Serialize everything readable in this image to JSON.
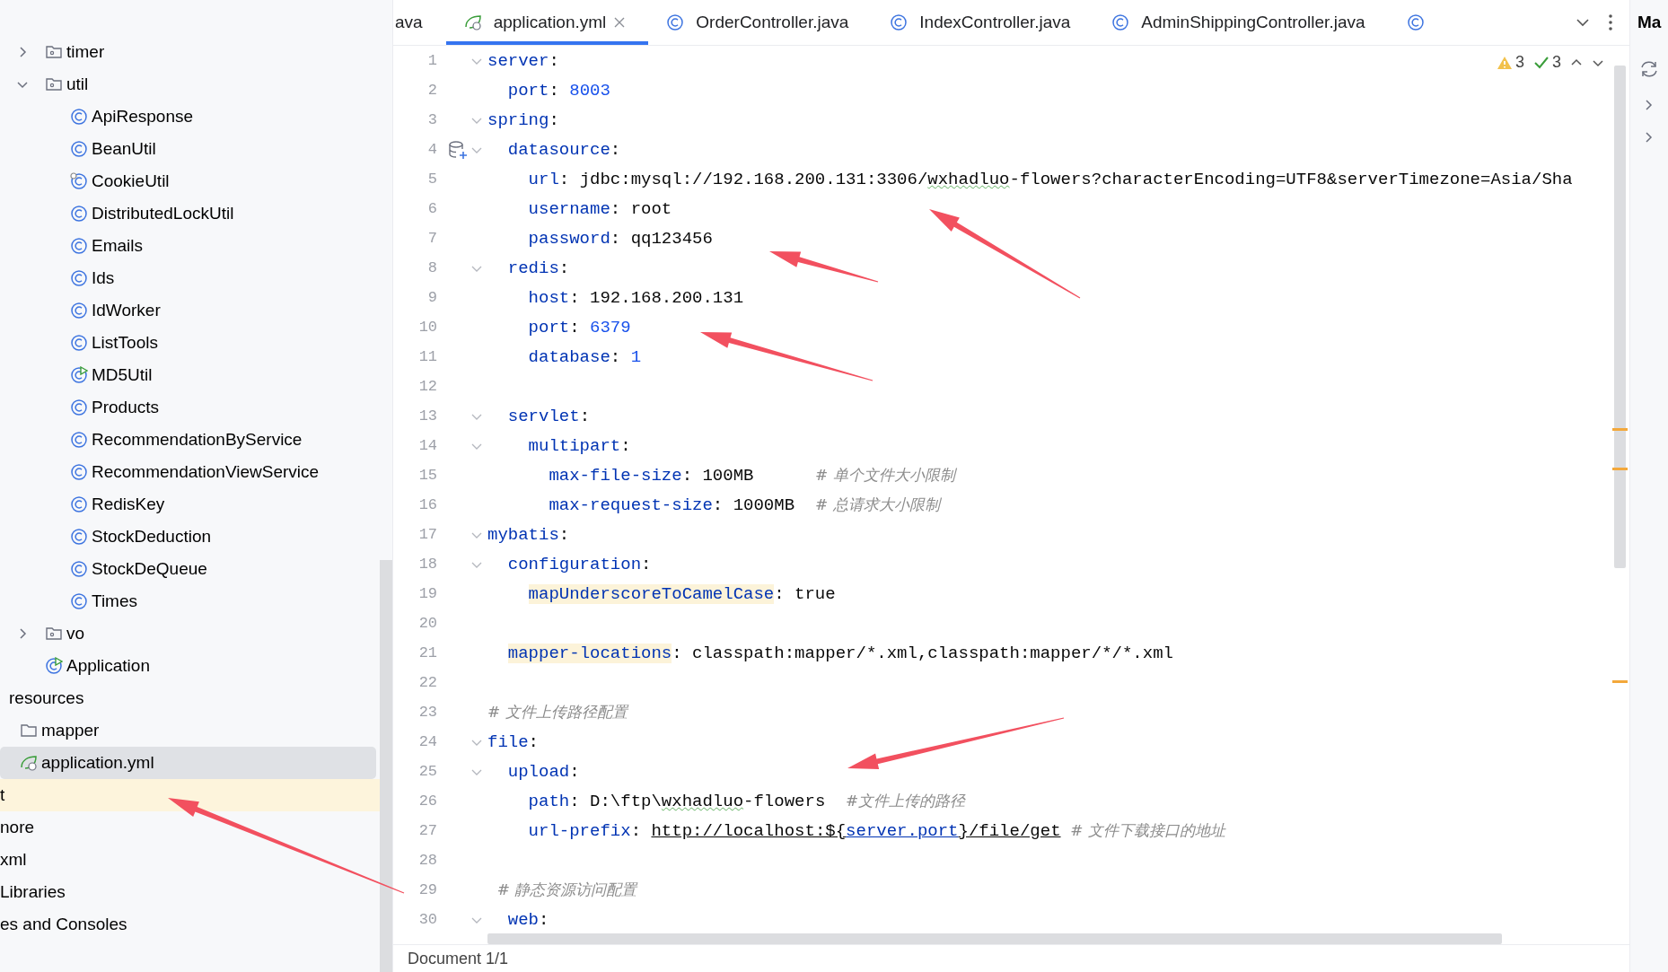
{
  "project_tree": [
    {
      "children": [
        {
          "children": [
            {
              "children": [
                {
                  "label": "timer",
                  "kind": "package",
                  "expanded": false,
                  "selected": false,
                  "excluded": false
                },
                {
                  "label": "util",
                  "kind": "package",
                  "expanded": true,
                  "selected": false,
                  "excluded": false,
                  "children": [
                    {
                      "label": "ApiResponse",
                      "kind": "class",
                      "selected": false,
                      "excluded": false
                    },
                    {
                      "label": "BeanUtil",
                      "kind": "class",
                      "selected": false,
                      "excluded": false
                    },
                    {
                      "label": "CookieUtil",
                      "kind": "class-badge",
                      "selected": false,
                      "excluded": false
                    },
                    {
                      "label": "DistributedLockUtil",
                      "kind": "class",
                      "selected": false,
                      "excluded": false
                    },
                    {
                      "label": "Emails",
                      "kind": "class",
                      "selected": false,
                      "excluded": false
                    },
                    {
                      "label": "Ids",
                      "kind": "class",
                      "selected": false,
                      "excluded": false
                    },
                    {
                      "label": "IdWorker",
                      "kind": "class",
                      "selected": false,
                      "excluded": false
                    },
                    {
                      "label": "ListTools",
                      "kind": "class",
                      "selected": false,
                      "excluded": false
                    },
                    {
                      "label": "MD5Util",
                      "kind": "class-run",
                      "selected": false,
                      "excluded": false
                    },
                    {
                      "label": "Products",
                      "kind": "class",
                      "selected": false,
                      "excluded": false
                    },
                    {
                      "label": "RecommendationByService",
                      "kind": "class",
                      "selected": false,
                      "excluded": false
                    },
                    {
                      "label": "RecommendationViewService",
                      "kind": "class",
                      "selected": false,
                      "excluded": false
                    },
                    {
                      "label": "RedisKey",
                      "kind": "class",
                      "selected": false,
                      "excluded": false
                    },
                    {
                      "label": "StockDeduction",
                      "kind": "class",
                      "selected": false,
                      "excluded": false
                    },
                    {
                      "label": "StockDeQueue",
                      "kind": "class",
                      "selected": false,
                      "excluded": false
                    },
                    {
                      "label": "Times",
                      "kind": "class",
                      "selected": false,
                      "excluded": false
                    }
                  ]
                },
                {
                  "label": "vo",
                  "kind": "package",
                  "expanded": false,
                  "selected": false,
                  "excluded": false
                },
                {
                  "label": "Application",
                  "kind": "class-run",
                  "selected": false,
                  "excluded": false
                }
              ]
            }
          ]
        },
        {
          "label": "resources",
          "selected": false,
          "excluded": false,
          "children": [
            {
              "label": "mapper",
              "kind": "folder",
              "selected": false,
              "excluded": false
            },
            {
              "label": "application.yml",
              "kind": "spring",
              "selected": true,
              "excluded": false
            }
          ]
        }
      ]
    },
    {
      "label": "t",
      "selected": false,
      "excluded": true
    },
    {
      "label": "nore",
      "selected": false,
      "excluded": false
    },
    {
      "label": "xml",
      "selected": false,
      "excluded": false
    },
    {
      "label": "Libraries",
      "selected": false,
      "excluded": false
    },
    {
      "label": "es and Consoles",
      "selected": false,
      "excluded": false
    }
  ],
  "tabs": [
    {
      "label": "ava",
      "selected": false
    },
    {
      "label": "application.yml",
      "kind": "spring",
      "selected": true,
      "closable": true
    },
    {
      "label": "OrderController.java",
      "kind": "class",
      "selected": false
    },
    {
      "label": "IndexController.java",
      "kind": "class",
      "selected": false
    },
    {
      "label": "AdminShippingController.java",
      "kind": "class",
      "selected": false
    },
    {
      "kind": "class",
      "selected": false
    }
  ],
  "right_panel": {
    "title": "Ma"
  },
  "inspections": {
    "warnings": "3",
    "passed": "3"
  },
  "editor_lines": [
    {
      "n": "1",
      "fold": true,
      "tokens": [
        {
          "kind": "key",
          "text": "server"
        },
        {
          "kind": "plain",
          "text": ":"
        }
      ]
    },
    {
      "n": "2",
      "tokens": [
        {
          "kind": "key",
          "text": "  port"
        },
        {
          "kind": "plain",
          "text": ": "
        },
        {
          "kind": "number",
          "text": "8003"
        }
      ]
    },
    {
      "n": "3",
      "fold": true,
      "tokens": [
        {
          "kind": "key",
          "text": "spring"
        },
        {
          "kind": "plain",
          "text": ":"
        }
      ]
    },
    {
      "n": "4",
      "fold": true,
      "tokens": [
        {
          "kind": "key",
          "text": "  datasource"
        },
        {
          "kind": "plain",
          "text": ":"
        }
      ]
    },
    {
      "n": "5",
      "tokens": [
        {
          "kind": "key",
          "text": "    url"
        },
        {
          "kind": "plain",
          "text": ": jdbc:mysql://192.168.200.131:3306/"
        },
        {
          "kind": "typo",
          "text": "wxhadluo"
        },
        {
          "kind": "plain",
          "text": "-flowers?characterEncoding=UTF8&serverTimezone=Asia/Sha"
        }
      ]
    },
    {
      "n": "6",
      "tokens": [
        {
          "kind": "key",
          "text": "    username"
        },
        {
          "kind": "plain",
          "text": ": root"
        }
      ]
    },
    {
      "n": "7",
      "tokens": [
        {
          "kind": "key",
          "text": "    password"
        },
        {
          "kind": "plain",
          "text": ": qq123456"
        }
      ]
    },
    {
      "n": "8",
      "fold": true,
      "tokens": [
        {
          "kind": "key",
          "text": "  redis"
        },
        {
          "kind": "plain",
          "text": ":"
        }
      ]
    },
    {
      "n": "9",
      "tokens": [
        {
          "kind": "key",
          "text": "    host"
        },
        {
          "kind": "plain",
          "text": ": 192.168.200.131"
        }
      ]
    },
    {
      "n": "10",
      "tokens": [
        {
          "kind": "key",
          "text": "    port"
        },
        {
          "kind": "plain",
          "text": ": "
        },
        {
          "kind": "number",
          "text": "6379"
        }
      ]
    },
    {
      "n": "11",
      "tokens": [
        {
          "kind": "key",
          "text": "    database"
        },
        {
          "kind": "plain",
          "text": ": "
        },
        {
          "kind": "number",
          "text": "1"
        }
      ]
    },
    {
      "n": "12"
    },
    {
      "n": "13",
      "fold": true,
      "tokens": [
        {
          "kind": "key",
          "text": "  servlet"
        },
        {
          "kind": "plain",
          "text": ":"
        }
      ]
    },
    {
      "n": "14",
      "fold": true,
      "tokens": [
        {
          "kind": "key",
          "text": "    multipart"
        },
        {
          "kind": "plain",
          "text": ":"
        }
      ]
    },
    {
      "n": "15",
      "tokens": [
        {
          "kind": "key",
          "text": "      max-file-size"
        },
        {
          "kind": "plain",
          "text": ": 100MB      "
        },
        {
          "kind": "comment",
          "text": "# 单个文件大小限制"
        }
      ]
    },
    {
      "n": "16",
      "tokens": [
        {
          "kind": "key",
          "text": "      max-request-size"
        },
        {
          "kind": "plain",
          "text": ": 1000MB  "
        },
        {
          "kind": "comment",
          "text": "# 总请求大小限制"
        }
      ]
    },
    {
      "n": "17",
      "fold": true,
      "tokens": [
        {
          "kind": "key",
          "text": "mybatis"
        },
        {
          "kind": "plain",
          "text": ":"
        }
      ]
    },
    {
      "n": "18",
      "fold": true,
      "tokens": [
        {
          "kind": "key",
          "text": "  configuration"
        },
        {
          "kind": "plain",
          "text": ":"
        }
      ]
    },
    {
      "n": "19",
      "tokens": [
        {
          "kind": "highlighted_key",
          "text": "    mapUnderscoreToCamelCase"
        },
        {
          "kind": "plain",
          "text": ": true"
        }
      ]
    },
    {
      "n": "20"
    },
    {
      "n": "21",
      "tokens": [
        {
          "kind": "highlighted_key",
          "text": "  mapper-locations"
        },
        {
          "kind": "plain",
          "text": ": classpath:mapper/*.xml,classpath:mapper/*/*.xml"
        }
      ]
    },
    {
      "n": "22"
    },
    {
      "n": "23",
      "tokens": [
        {
          "kind": "comment",
          "text": "# 文件上传路径配置"
        }
      ]
    },
    {
      "n": "24",
      "fold": true,
      "tokens": [
        {
          "kind": "key",
          "text": "file"
        },
        {
          "kind": "plain",
          "text": ":"
        }
      ]
    },
    {
      "n": "25",
      "fold": true,
      "tokens": [
        {
          "kind": "key",
          "text": "  upload"
        },
        {
          "kind": "plain",
          "text": ":"
        }
      ]
    },
    {
      "n": "26",
      "tokens": [
        {
          "kind": "key",
          "text": "    path"
        },
        {
          "kind": "plain",
          "text": ": D:\\ftp\\"
        },
        {
          "kind": "typo",
          "text": "wxhadluo"
        },
        {
          "kind": "plain",
          "text": "-flowers  "
        },
        {
          "kind": "comment",
          "text": "#文件上传的路径"
        }
      ]
    },
    {
      "n": "27",
      "tokens": [
        {
          "kind": "key",
          "text": "    url-prefix"
        },
        {
          "kind": "plain",
          "text": ": "
        },
        {
          "kind": "link",
          "text": "http://localhost:${"
        },
        {
          "kind": "link_key",
          "text": "server.port"
        },
        {
          "kind": "link",
          "text": "}/file/get"
        },
        {
          "kind": "comment",
          "text": "  # 文件下载接口的地址"
        }
      ]
    },
    {
      "n": "28"
    },
    {
      "n": "29",
      "tokens": [
        {
          "kind": "comment",
          "text": "  # 静态资源访问配置"
        }
      ]
    },
    {
      "n": "30",
      "fold": true,
      "tokens": [
        {
          "kind": "key",
          "text": "  web"
        },
        {
          "kind": "plain",
          "text": ":"
        }
      ]
    }
  ],
  "status_bar": {
    "text": "Document 1/1"
  }
}
